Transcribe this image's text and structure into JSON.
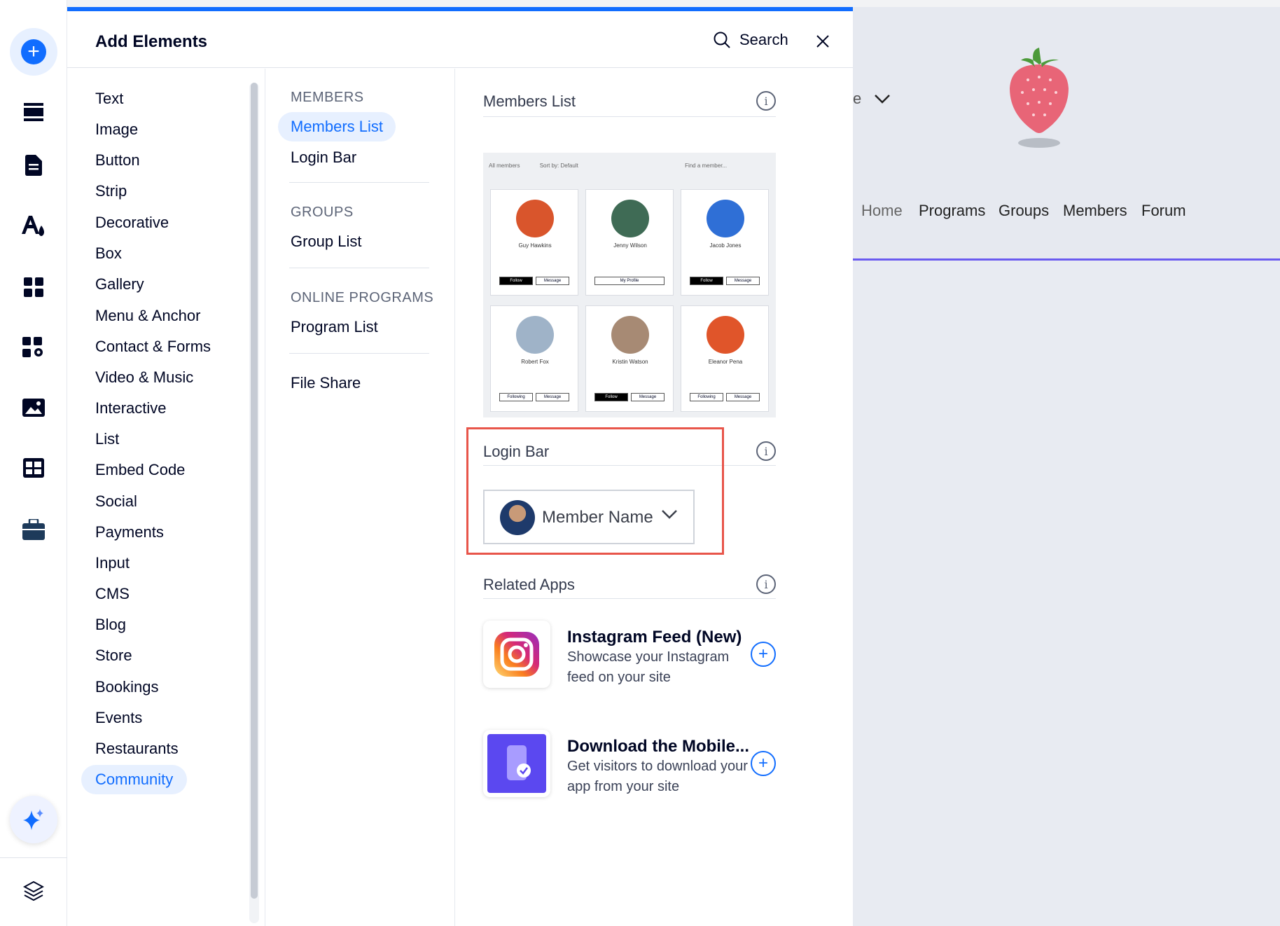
{
  "panel": {
    "title": "Add Elements",
    "search_label": "Search"
  },
  "categories": [
    {
      "label": "Text"
    },
    {
      "label": "Image"
    },
    {
      "label": "Button"
    },
    {
      "label": "Strip"
    },
    {
      "label": "Decorative"
    },
    {
      "label": "Box"
    },
    {
      "label": "Gallery"
    },
    {
      "label": "Menu & Anchor"
    },
    {
      "label": "Contact & Forms"
    },
    {
      "label": "Video & Music"
    },
    {
      "label": "Interactive"
    },
    {
      "label": "List"
    },
    {
      "label": "Embed Code"
    },
    {
      "label": "Social"
    },
    {
      "label": "Payments"
    },
    {
      "label": "Input"
    },
    {
      "label": "CMS"
    },
    {
      "label": "Blog"
    },
    {
      "label": "Store"
    },
    {
      "label": "Bookings"
    },
    {
      "label": "Events"
    },
    {
      "label": "Restaurants"
    },
    {
      "label": "Community",
      "active": true
    }
  ],
  "subcategories": {
    "members_heading": "MEMBERS",
    "members_list": "Members List",
    "login_bar": "Login Bar",
    "groups_heading": "GROUPS",
    "group_list": "Group List",
    "programs_heading": "ONLINE PROGRAMS",
    "program_list": "Program List",
    "file_share": "File Share"
  },
  "content": {
    "members_list_title": "Members List",
    "login_bar_title": "Login Bar",
    "related_apps_title": "Related Apps",
    "info_glyph": "i",
    "preview": {
      "filter": "All members",
      "sort": "Sort by: Default",
      "find": "Find a member...",
      "members": [
        {
          "name": "Guy Hawkins",
          "follow": "Follow",
          "message": "Message",
          "color": "#d9552c"
        },
        {
          "name": "Jenny Wilson",
          "follow": "My Profile",
          "message": "",
          "color": "#3f6b55"
        },
        {
          "name": "Jacob Jones",
          "follow": "Follow",
          "message": "Message",
          "color": "#2f6fd6"
        },
        {
          "name": "Robert Fox",
          "follow": "Following",
          "message": "Message",
          "color": "#9fb3c8"
        },
        {
          "name": "Kristin Watson",
          "follow": "Follow",
          "message": "Message",
          "color": "#a78a74"
        },
        {
          "name": "Eleanor Pena",
          "follow": "Following",
          "message": "Message",
          "color": "#e0552a"
        }
      ]
    },
    "login_widget_name": "Member Name",
    "apps": [
      {
        "title": "Instagram Feed (New)",
        "description": "Showcase your Instagram feed on your site"
      },
      {
        "title": "Download the Mobile...",
        "description": "Get visitors to download your app from your site"
      }
    ]
  },
  "site": {
    "nav": [
      "Home",
      "Programs",
      "Groups",
      "Members",
      "Forum"
    ],
    "partial_text": "e"
  },
  "colors": {
    "accent": "#116dff",
    "highlight": "#e8554a",
    "site_line": "#6a5bf0"
  }
}
